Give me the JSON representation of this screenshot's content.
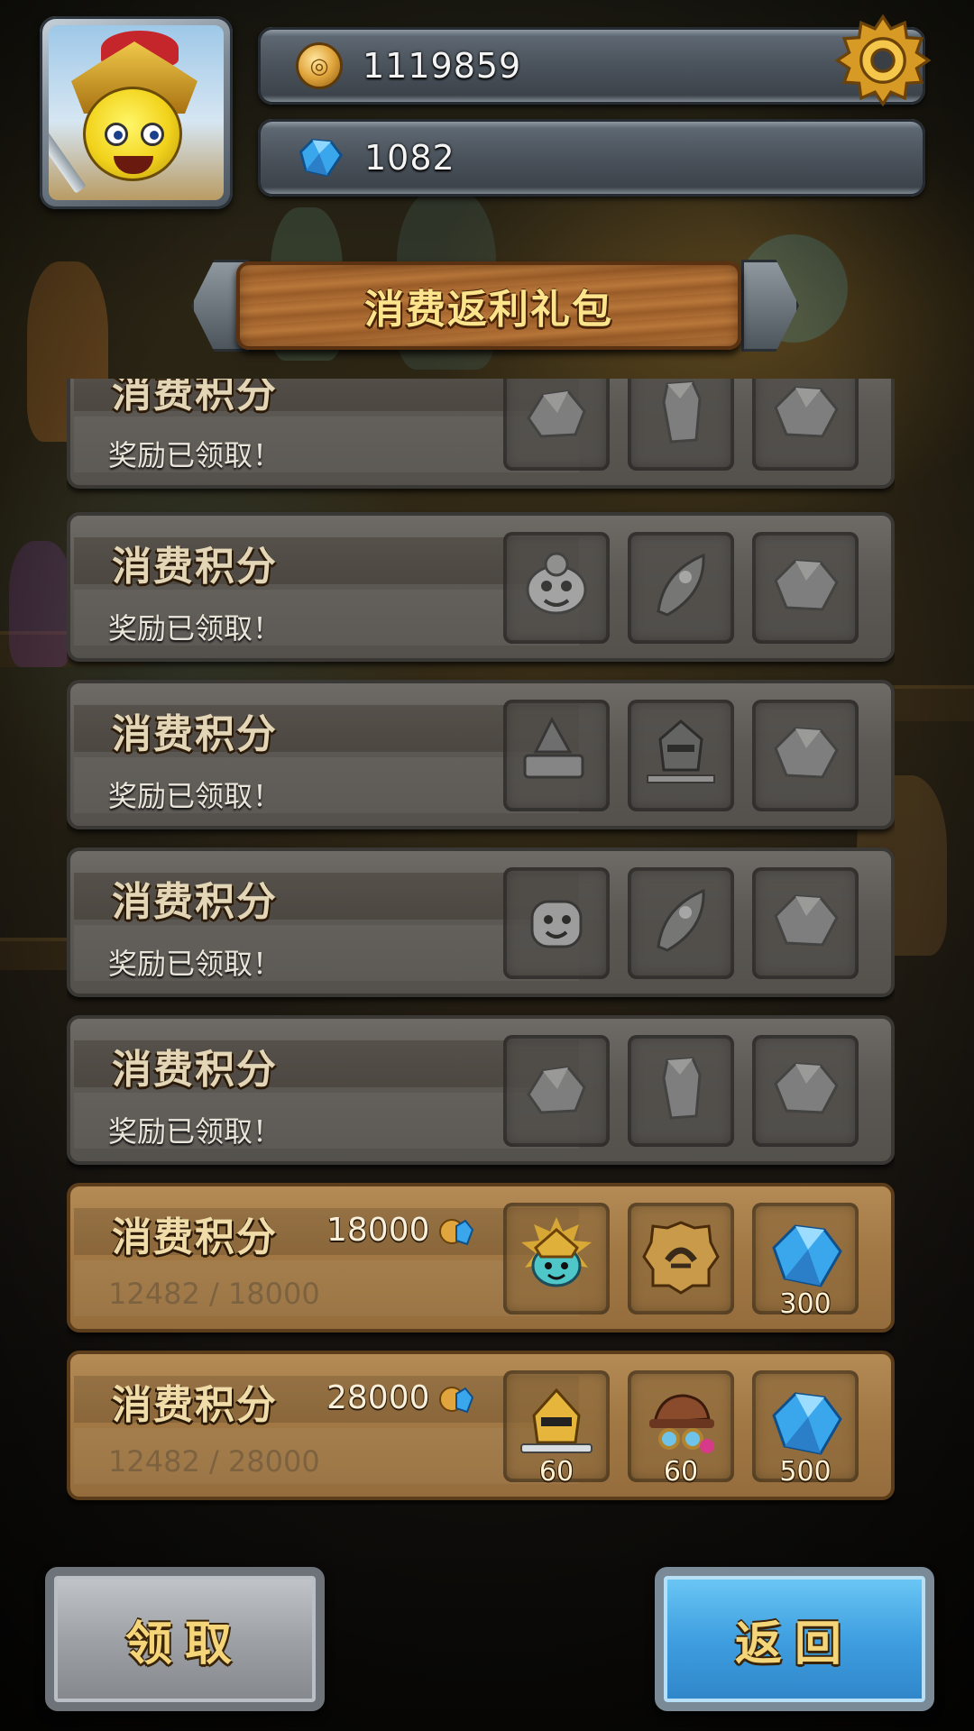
{
  "header": {
    "coins": "1119859",
    "gems": "1082"
  },
  "title": "消费返利礼包",
  "cards": [
    {
      "title": "消费积分",
      "status": "奖励已领取！",
      "claimed": true,
      "items": [
        "ore",
        "crystal",
        "ore"
      ]
    },
    {
      "title": "消费积分",
      "status": "奖励已领取！",
      "claimed": true,
      "items": [
        "hero-sheep",
        "rocket",
        "ore"
      ]
    },
    {
      "title": "消费积分",
      "status": "奖励已领取！",
      "claimed": true,
      "items": [
        "wizard-book",
        "armored-knight",
        "ore"
      ]
    },
    {
      "title": "消费积分",
      "status": "奖励已领取！",
      "claimed": true,
      "items": [
        "hero-robot",
        "rocket",
        "ore"
      ]
    },
    {
      "title": "消费积分",
      "status": "奖励已领取！",
      "claimed": true,
      "items": [
        "ore",
        "crystal",
        "ore"
      ]
    },
    {
      "title": "消费积分",
      "threshold": "18000",
      "progress": "12482 / 18000",
      "claimed": false,
      "items": [
        {
          "name": "golden-king-hero",
          "qty": ""
        },
        {
          "name": "stone-rune",
          "qty": ""
        },
        {
          "name": "blue-gem",
          "qty": "300"
        }
      ]
    },
    {
      "title": "消费积分",
      "threshold": "28000",
      "progress": "12482 / 28000",
      "claimed": false,
      "items": [
        {
          "name": "knight-helmet",
          "qty": "60"
        },
        {
          "name": "pilot-hat",
          "qty": "60"
        },
        {
          "name": "blue-gem",
          "qty": "500"
        }
      ]
    }
  ],
  "buttons": {
    "claim": "领取",
    "back": "返回"
  },
  "colors": {
    "gold_text": "#fbe48c",
    "active_card": "#a27945",
    "claimed_card": "#5c5954",
    "back_button": "#3f9fe0"
  },
  "icons": {
    "coin": "coin-icon",
    "gem": "gem-icon",
    "settings": "gear-icon"
  }
}
